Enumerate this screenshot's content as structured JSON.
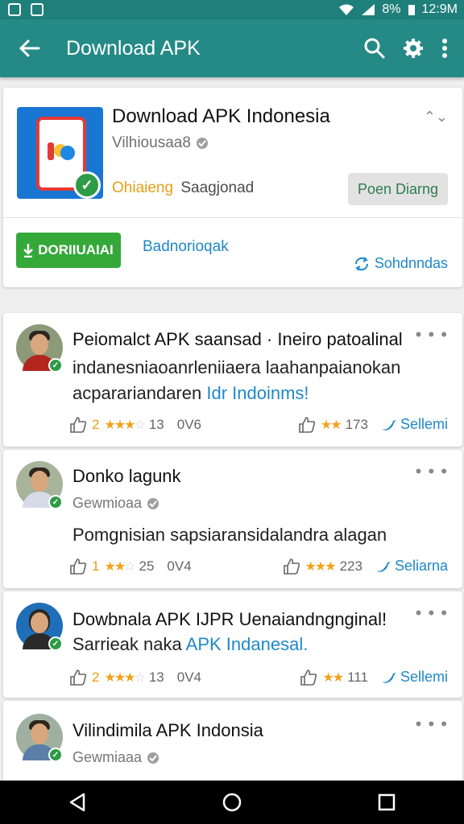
{
  "status_bar": {
    "battery": "8%",
    "time": "12:9M"
  },
  "app_bar": {
    "title": "Download APK"
  },
  "app_card": {
    "title": "Download APK Indonesia",
    "subtitle": "Vilhiousaa8",
    "meta_accent": "Ohiaieng",
    "meta_dev": "Saagjonad",
    "open_button": "Poen Diarng",
    "download_button": "DORIIUAIAI",
    "download_link": "Badnorioqak",
    "side_link": "Sohdnndas"
  },
  "reviews": [
    {
      "title": "Peiomalct APK saansad · Ineiro patoalinal",
      "text": "indanesniaoanrleniiaera laahanpaianokan",
      "text2": "acparariandaren",
      "text2_link": "Idr Indoinms!",
      "likes": "2",
      "rating": "13",
      "views": "0V6",
      "right_count": "173",
      "share": "Sellemi"
    },
    {
      "title": "Donko lagunk",
      "subtitle": "Gewmioaa",
      "text": "Pomgnisian sapsiaransidalandra alagan",
      "likes": "1",
      "rating": "25",
      "views": "0V4",
      "right_count": "223",
      "share": "Seliarna"
    },
    {
      "title": "Dowbnala APK IJPR Uenaiandngnginal!",
      "text": "Sarrieak naka",
      "text_link": "APK Indanesal.",
      "likes": "2",
      "rating": "13",
      "views": "0V4",
      "right_count": "111",
      "share": "Sellemi"
    },
    {
      "title": "Vilindimila APK Indonsia",
      "subtitle": "Gewmiaaa"
    }
  ]
}
